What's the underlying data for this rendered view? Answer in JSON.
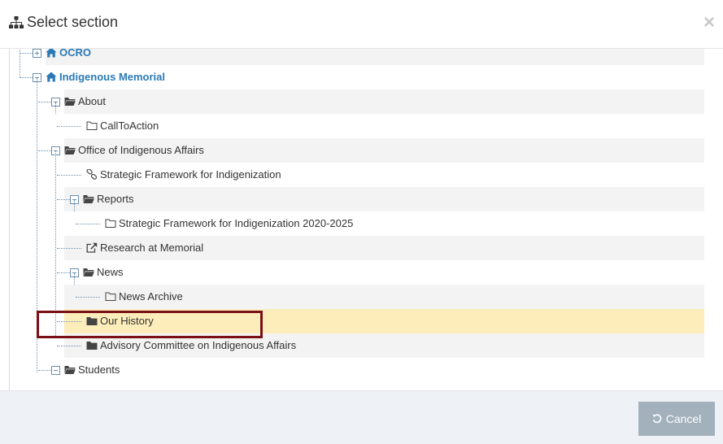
{
  "header": {
    "title": "Select section",
    "title_icon": "sitemap-icon",
    "close_icon": "close-icon",
    "close_glyph": "×"
  },
  "tree": {
    "nodes": [
      {
        "label": "OCRO",
        "icon": "home-icon",
        "toggle": "expand",
        "style": "home"
      },
      {
        "label": "Indigenous Memorial",
        "icon": "home-icon",
        "toggle": "collapse",
        "style": "home"
      },
      {
        "label": "About",
        "icon": "folder-open-icon",
        "toggle": "collapse",
        "style": "plain"
      },
      {
        "label": "CallToAction",
        "icon": "folder-outline-icon",
        "toggle": "",
        "style": "plain"
      },
      {
        "label": "Office of Indigenous Affairs",
        "icon": "folder-open-icon",
        "toggle": "collapse",
        "style": "plain"
      },
      {
        "label": "Strategic Framework for Indigenization",
        "icon": "link-icon",
        "toggle": "",
        "style": "plain"
      },
      {
        "label": "Reports",
        "icon": "folder-open-icon",
        "toggle": "collapse",
        "style": "plain"
      },
      {
        "label": "Strategic Framework for Indigenization 2020-2025",
        "icon": "folder-outline-icon",
        "toggle": "",
        "style": "plain"
      },
      {
        "label": "Research at Memorial",
        "icon": "external-link-icon",
        "toggle": "",
        "style": "plain"
      },
      {
        "label": "News",
        "icon": "folder-open-icon",
        "toggle": "collapse",
        "style": "plain"
      },
      {
        "label": "News Archive",
        "icon": "folder-outline-icon",
        "toggle": "",
        "style": "plain"
      },
      {
        "label": "Our History",
        "icon": "folder-filled-icon",
        "toggle": "",
        "style": "plain",
        "selected": true
      },
      {
        "label": "Advisory Committee on Indigenous Affairs",
        "icon": "folder-filled-icon",
        "toggle": "",
        "style": "plain"
      },
      {
        "label": "Students",
        "icon": "folder-open-icon",
        "toggle": "collapse",
        "style": "plain"
      }
    ]
  },
  "footer": {
    "cancel_label": "Cancel",
    "cancel_icon": "undo-icon"
  },
  "colors": {
    "link_blue": "#2a7ab8",
    "selected_row": "#fcedba",
    "highlight_border": "#7a1016",
    "cancel_button": "#a3b1bd"
  }
}
